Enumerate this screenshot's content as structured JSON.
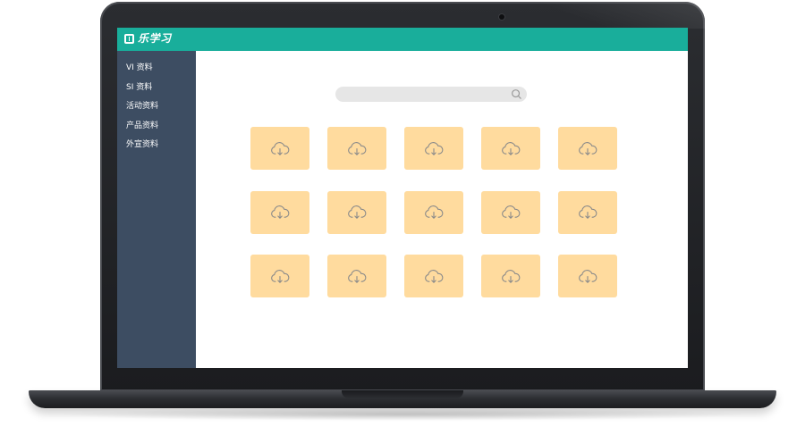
{
  "app": {
    "logo_text": "乐学习"
  },
  "sidebar": {
    "items": [
      {
        "label": "VI 资料"
      },
      {
        "label": "SI 资料"
      },
      {
        "label": "活动资料"
      },
      {
        "label": "产品资料"
      },
      {
        "label": "外宣资料"
      }
    ]
  },
  "search": {
    "value": "",
    "placeholder": ""
  },
  "grid": {
    "tiles": 15,
    "tile_icon": "cloud-download-icon",
    "tile_color": "#ffdb9e"
  },
  "colors": {
    "header": "#19ae9b",
    "sidebar": "#3d4d62",
    "search_bg": "#e6e6e6"
  }
}
